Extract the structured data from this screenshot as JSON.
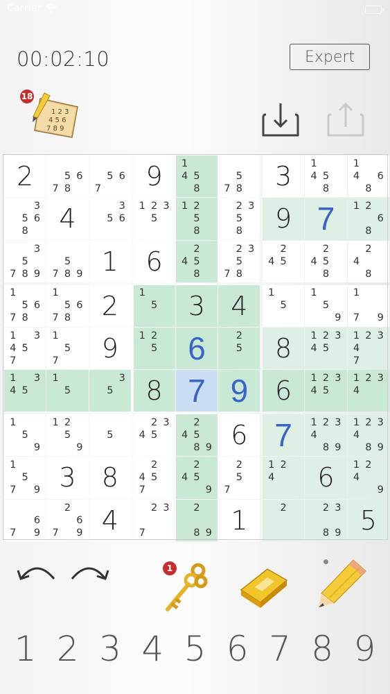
{
  "status": {
    "carrier": "Carrier"
  },
  "game": {
    "timer": "00:02:10",
    "level": "Expert",
    "notes_badge": "18",
    "hint_badge": "1"
  },
  "icons": [
    "wifi-icon",
    "battery-icon",
    "notes-icon",
    "download-icon",
    "upload-icon",
    "undo-icon",
    "redo-icon",
    "key-icon",
    "eraser-icon",
    "pencil-icon"
  ],
  "colors": {
    "accent_blue": "#3a64c8",
    "highlight_green": "#ddf0e3",
    "region_green": "#c9e8d6",
    "selected_blue": "#c9ddf3",
    "badge_red": "#c62e2e"
  },
  "numpad": [
    "1",
    "2",
    "3",
    "4",
    "5",
    "6",
    "7",
    "8",
    "9"
  ],
  "board": [
    [
      {
        "g": "2"
      },
      {
        "n": "56 78"
      },
      {
        "n": "56 7"
      },
      {
        "g": "9"
      },
      {
        "n": "14 5 8"
      },
      {
        "n": "5 78"
      },
      {
        "g": "3"
      },
      {
        "n": "14 5 8"
      },
      {
        "n": "14 6 8"
      }
    ],
    [
      {
        "n": "3 56 8"
      },
      {
        "g": "4"
      },
      {
        "n": "3 56"
      },
      {
        "n": "123 5"
      },
      {
        "n": "12 5 8"
      },
      {
        "n": "23 5 8"
      },
      {
        "g": "9"
      },
      {
        "u": "7"
      },
      {
        "n": "12 6 8"
      }
    ],
    [
      {
        "n": "3 5 789"
      },
      {
        "n": "5 789"
      },
      {
        "g": "1"
      },
      {
        "g": "6"
      },
      {
        "n": "2 45 8"
      },
      {
        "n": "23 5 78"
      },
      {
        "n": "2 45"
      },
      {
        "n": "2 45 8"
      },
      {
        "n": "2 4 8"
      }
    ],
    [
      {
        "n": "1 56 78"
      },
      {
        "n": "1 56 78"
      },
      {
        "g": "2"
      },
      {
        "n": "1 5"
      },
      {
        "g": "3"
      },
      {
        "g": "4"
      },
      {
        "n": "1 5"
      },
      {
        "n": "1 5 9"
      },
      {
        "n": "1 7 9"
      }
    ],
    [
      {
        "n": "1 3 45 7"
      },
      {
        "n": "1 5 7"
      },
      {
        "g": "9"
      },
      {
        "n": "12 5"
      },
      {
        "u": "6"
      },
      {
        "n": "2 5"
      },
      {
        "g": "8"
      },
      {
        "n": "123 45"
      },
      {
        "n": "123 4 7"
      }
    ],
    [
      {
        "n": "1 3 45"
      },
      {
        "n": "1 5"
      },
      {
        "n": "3 5"
      },
      {
        "g": "8"
      },
      {
        "u": "7"
      },
      {
        "u": "9"
      },
      {
        "g": "6"
      },
      {
        "n": "123 45"
      },
      {
        "n": "123 4"
      }
    ],
    [
      {
        "n": "1 5 9"
      },
      {
        "n": "12 5 9"
      },
      {
        "n": "5"
      },
      {
        "n": "23 45"
      },
      {
        "n": "2 45 89"
      },
      {
        "g": "6"
      },
      {
        "u": "7"
      },
      {
        "n": "123 4 89"
      },
      {
        "n": "123 4 89"
      }
    ],
    [
      {
        "n": "1 5 79"
      },
      {
        "g": "3"
      },
      {
        "g": "8"
      },
      {
        "n": "2 45 7"
      },
      {
        "n": "2 45 9"
      },
      {
        "n": "2 5 7"
      },
      {
        "n": "12 4"
      },
      {
        "g": "6"
      },
      {
        "n": "12 4 9"
      }
    ],
    [
      {
        "n": "6 79"
      },
      {
        "n": "2 6 79"
      },
      {
        "g": "4"
      },
      {
        "n": "23 7"
      },
      {
        "n": "2 89"
      },
      {
        "g": "1"
      },
      {
        "n": "2"
      },
      {
        "n": "23 89"
      },
      {
        "g": "5"
      }
    ]
  ]
}
